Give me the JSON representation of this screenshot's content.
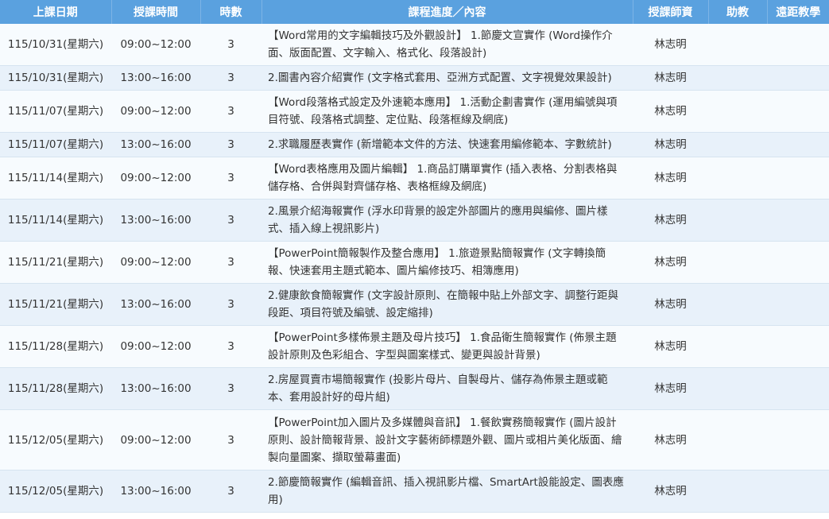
{
  "headers": [
    "上課日期",
    "授課時間",
    "時數",
    "課程進度／內容",
    "授課師資",
    "助教",
    "遠距教學"
  ],
  "rows": [
    {
      "date": "115/10/31(星期六)",
      "time": "09:00~12:00",
      "hours": "3",
      "content": "【Word常用的文字編輯技巧及外觀設計】 1.節慶文宣實作 (Word操作介面、版面配置、文字輸入、格式化、段落設計)",
      "teacher": "林志明",
      "assistant": "",
      "remote": ""
    },
    {
      "date": "115/10/31(星期六)",
      "time": "13:00~16:00",
      "hours": "3",
      "content": "2.圖書內容介紹實作 (文字格式套用、亞洲方式配置、文字視覺效果設計)",
      "teacher": "林志明",
      "assistant": "",
      "remote": ""
    },
    {
      "date": "115/11/07(星期六)",
      "time": "09:00~12:00",
      "hours": "3",
      "content": "【Word段落格式設定及外速範本應用】 1.活動企劃書實作 (運用編號與項目符號、段落格式調整、定位點、段落框線及網底)",
      "teacher": "林志明",
      "assistant": "",
      "remote": ""
    },
    {
      "date": "115/11/07(星期六)",
      "time": "13:00~16:00",
      "hours": "3",
      "content": "2.求職履歷表實作 (新增範本文件的方法、快速套用編修範本、字數統計)",
      "teacher": "林志明",
      "assistant": "",
      "remote": ""
    },
    {
      "date": "115/11/14(星期六)",
      "time": "09:00~12:00",
      "hours": "3",
      "content": "【Word表格應用及圖片編輯】 1.商品訂購單實作 (插入表格、分割表格與儲存格、合併與對齊儲存格、表格框線及網底)",
      "teacher": "林志明",
      "assistant": "",
      "remote": ""
    },
    {
      "date": "115/11/14(星期六)",
      "time": "13:00~16:00",
      "hours": "3",
      "content": "2.風景介紹海報實作 (浮水印背景的設定外部圖片的應用與編修、圖片樣式、插入線上視訊影片)",
      "teacher": "林志明",
      "assistant": "",
      "remote": ""
    },
    {
      "date": "115/11/21(星期六)",
      "time": "09:00~12:00",
      "hours": "3",
      "content": "【PowerPoint簡報製作及整合應用】 1.旅遊景點簡報實作 (文字轉換簡報、快速套用主題式範本、圖片編修技巧、相簿應用)",
      "teacher": "林志明",
      "assistant": "",
      "remote": ""
    },
    {
      "date": "115/11/21(星期六)",
      "time": "13:00~16:00",
      "hours": "3",
      "content": "2.健康飲食簡報實作 (文字設計原則、在簡報中貼上外部文字、調整行距與段距、項目符號及編號、設定縮排)",
      "teacher": "林志明",
      "assistant": "",
      "remote": ""
    },
    {
      "date": "115/11/28(星期六)",
      "time": "09:00~12:00",
      "hours": "3",
      "content": "【PowerPoint多樣佈景主題及母片技巧】 1.食品衛生簡報實作 (佈景主題設計原則及色彩組合、字型與圖案樣式、變更與設計背景)",
      "teacher": "林志明",
      "assistant": "",
      "remote": ""
    },
    {
      "date": "115/11/28(星期六)",
      "time": "13:00~16:00",
      "hours": "3",
      "content": "2.房屋買賣市場簡報實作 (投影片母片、自製母片、儲存為佈景主題或範本、套用設計好的母片組)",
      "teacher": "林志明",
      "assistant": "",
      "remote": ""
    },
    {
      "date": "115/12/05(星期六)",
      "time": "09:00~12:00",
      "hours": "3",
      "content": "【PowerPoint加入圖片及多媒體與音訊】 1.餐飲實務簡報實作 (圖片設計原則、設計簡報背景、設計文字藝術師標題外觀、圖片或相片美化版面、繪製向量圖案、擷取螢幕畫面)",
      "teacher": "林志明",
      "assistant": "",
      "remote": ""
    },
    {
      "date": "115/12/05(星期六)",
      "time": "13:00~16:00",
      "hours": "3",
      "content": "2.節慶簡報實作 (編輯音訊、插入視訊影片檔、SmartArt設能設定、圖表應用)",
      "teacher": "林志明",
      "assistant": "",
      "remote": ""
    }
  ]
}
